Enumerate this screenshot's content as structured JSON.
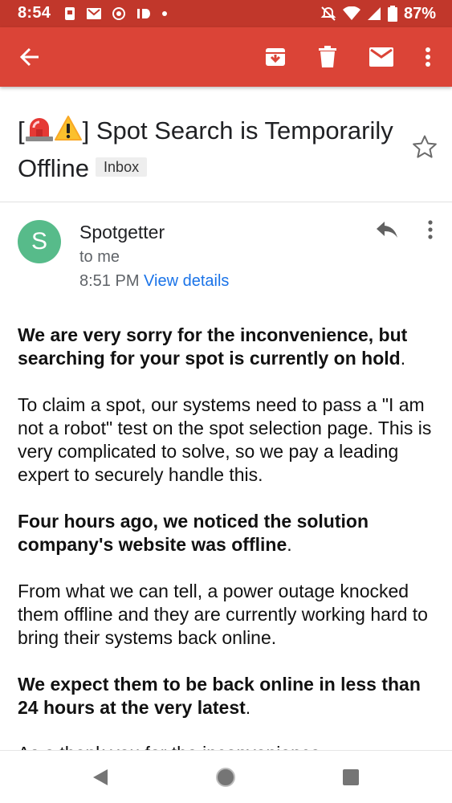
{
  "status_bar": {
    "time": "8:54",
    "battery": "87%",
    "left_icons": [
      "notification-icon",
      "gmail-icon",
      "app-icon",
      "id-icon",
      "dot-icon"
    ],
    "right_icons": [
      "do-not-disturb-icon",
      "wifi-icon",
      "signal-icon",
      "battery-icon"
    ]
  },
  "toolbar": {
    "icons": [
      "back-arrow-icon",
      "archive-icon",
      "delete-icon",
      "mail-icon",
      "more-vert-icon"
    ]
  },
  "email": {
    "subject_prefix": "[",
    "subject_suffix": "] Spot Search is Temporarily Offline",
    "subject_emojis": [
      "siren-emoji",
      "warning-emoji"
    ],
    "label": "Inbox",
    "sender_initial": "S",
    "sender_name": "Spotgetter",
    "recipient": "to me",
    "time": "8:51 PM",
    "view_details": "View details",
    "body": {
      "p1_bold": "We are very sorry for the inconvenience, but searching for your spot is currently on hold",
      "p1_end": ".",
      "p2": "To claim a spot, our systems need to pass a \"I am not a robot\" test on the spot selection page. This is very complicated to solve, so we pay a leading expert to securely handle this.",
      "p3_bold": "Four hours ago, we noticed the solution company's website was offline",
      "p3_end": ".",
      "p4": "From what we can tell, a power outage knocked them offline and they are currently working hard to bring their systems back online.",
      "p5_bold": "We expect them to be back online in less than 24 hours at the very latest",
      "p5_end": ".",
      "p6_partial": "As a thank you for the inconvenience"
    }
  },
  "colors": {
    "status_bar": "#c1372b",
    "app_bar": "#db4437",
    "avatar": "#57bb8a",
    "link": "#1a73e8"
  },
  "navbar": {
    "icons": [
      "back-triangle-icon",
      "home-circle-icon",
      "recents-square-icon"
    ]
  }
}
